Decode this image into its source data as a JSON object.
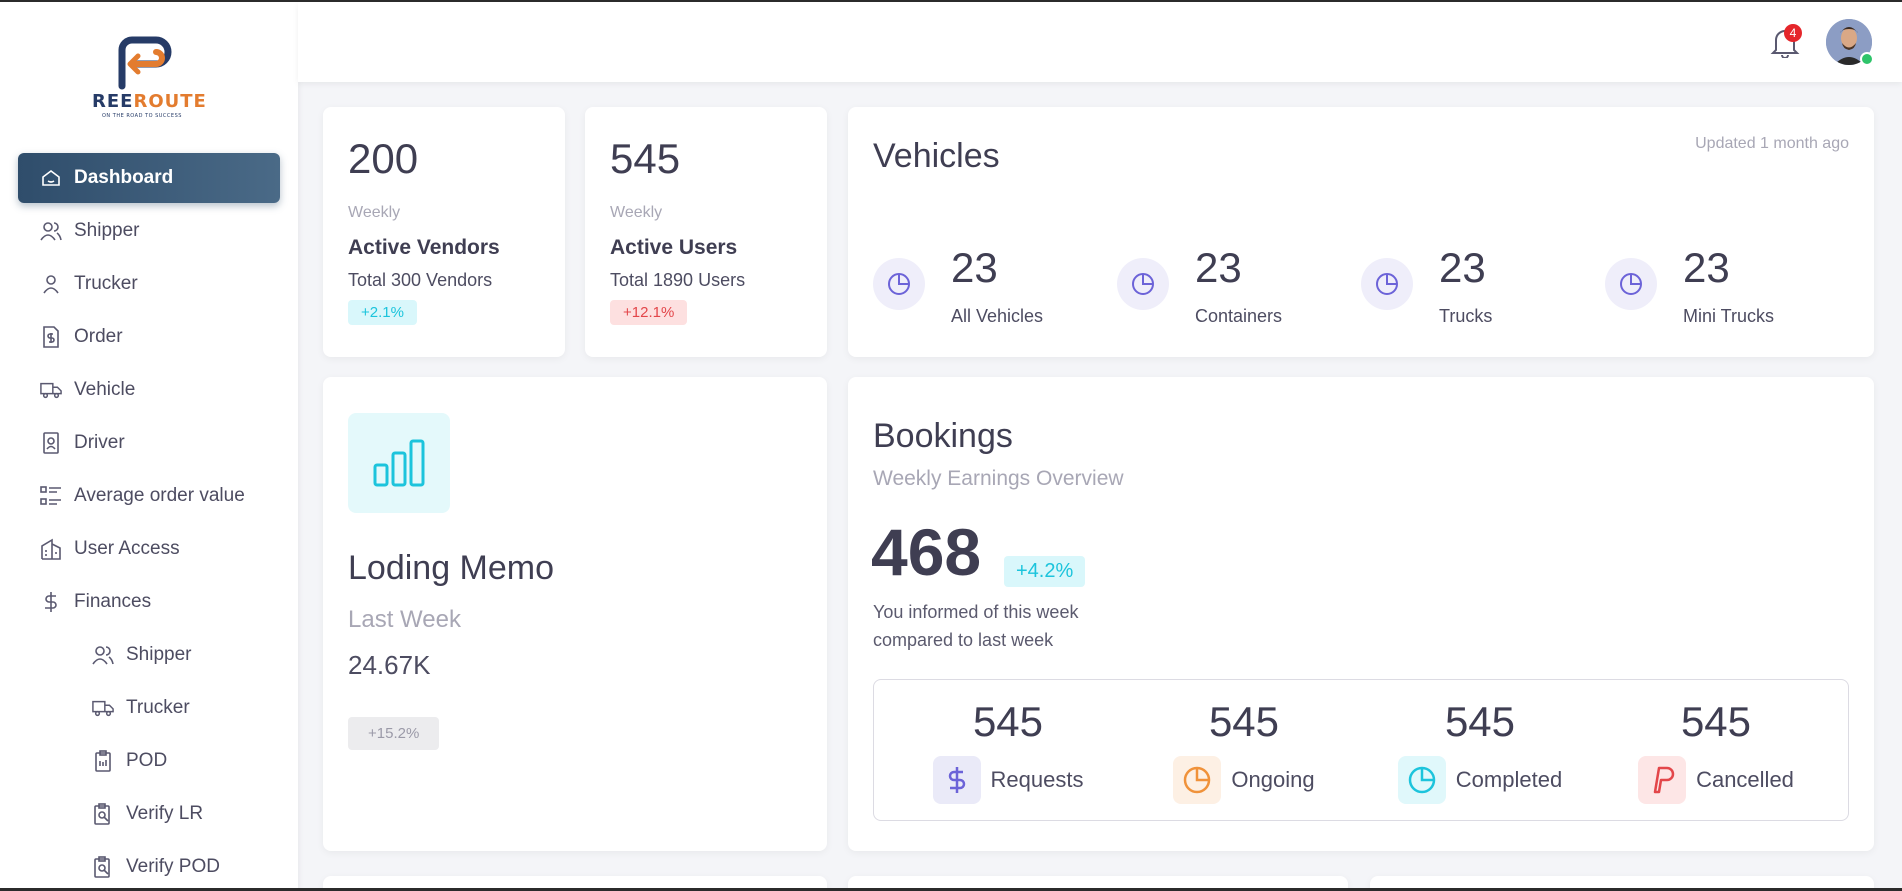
{
  "brand": {
    "logo_text_a": "REE",
    "logo_text_b": "ROUTE",
    "tagline": "ON THE ROAD TO SUCCESS"
  },
  "sidebar": {
    "items": [
      {
        "label": "Dashboard",
        "icon": "home-icon",
        "active": true
      },
      {
        "label": "Shipper",
        "icon": "users-icon"
      },
      {
        "label": "Trucker",
        "icon": "user-icon"
      },
      {
        "label": "Order",
        "icon": "invoice-icon"
      },
      {
        "label": "Vehicle",
        "icon": "truck-icon"
      },
      {
        "label": "Driver",
        "icon": "id-card-icon"
      },
      {
        "label": "Average order value",
        "icon": "list-icon"
      },
      {
        "label": "User Access",
        "icon": "building-icon"
      },
      {
        "label": "Finances",
        "icon": "dollar-icon"
      }
    ],
    "sub_items": [
      {
        "label": "Shipper",
        "icon": "users-icon"
      },
      {
        "label": "Trucker",
        "icon": "truck-icon"
      },
      {
        "label": "POD",
        "icon": "clipboard-icon"
      },
      {
        "label": "Verify LR",
        "icon": "clipboard-search-icon"
      },
      {
        "label": "Verify POD",
        "icon": "clipboard-search-icon"
      }
    ]
  },
  "topbar": {
    "notifications": "4"
  },
  "vendors_card": {
    "value": "200",
    "period": "Weekly",
    "title": "Active Vendors",
    "total": "Total 300 Vendors",
    "change": "+2.1%"
  },
  "users_card": {
    "value": "545",
    "period": "Weekly",
    "title": "Active Users",
    "total": "Total 1890 Users",
    "change": "+12.1%"
  },
  "vehicles": {
    "title": "Vehicles",
    "updated": "Updated 1 month ago",
    "items": [
      {
        "value": "23",
        "label": "All Vehicles"
      },
      {
        "value": "23",
        "label": "Containers"
      },
      {
        "value": "23",
        "label": "Trucks"
      },
      {
        "value": "23",
        "label": "Mini Trucks"
      }
    ]
  },
  "memo": {
    "title": "Loding Memo",
    "period": "Last Week",
    "value": "24.67K",
    "change": "+15.2%"
  },
  "bookings": {
    "title": "Bookings",
    "subtitle": "Weekly Earnings Overview",
    "value": "468",
    "change": "+4.2%",
    "note_line1": "You informed of this week",
    "note_line2": "compared to last week",
    "stats": [
      {
        "value": "545",
        "label": "Requests",
        "color": "#6c63d8"
      },
      {
        "value": "545",
        "label": "Ongoing",
        "color": "#f0923a"
      },
      {
        "value": "545",
        "label": "Completed",
        "color": "#1cc4dc"
      },
      {
        "value": "545",
        "label": "Cancelled",
        "color": "#e3464a"
      }
    ]
  },
  "colors": {
    "accent": "#2f4d6b",
    "cyan": "#1cc4dc",
    "red": "#e3464a",
    "purple": "#6c63d8"
  }
}
